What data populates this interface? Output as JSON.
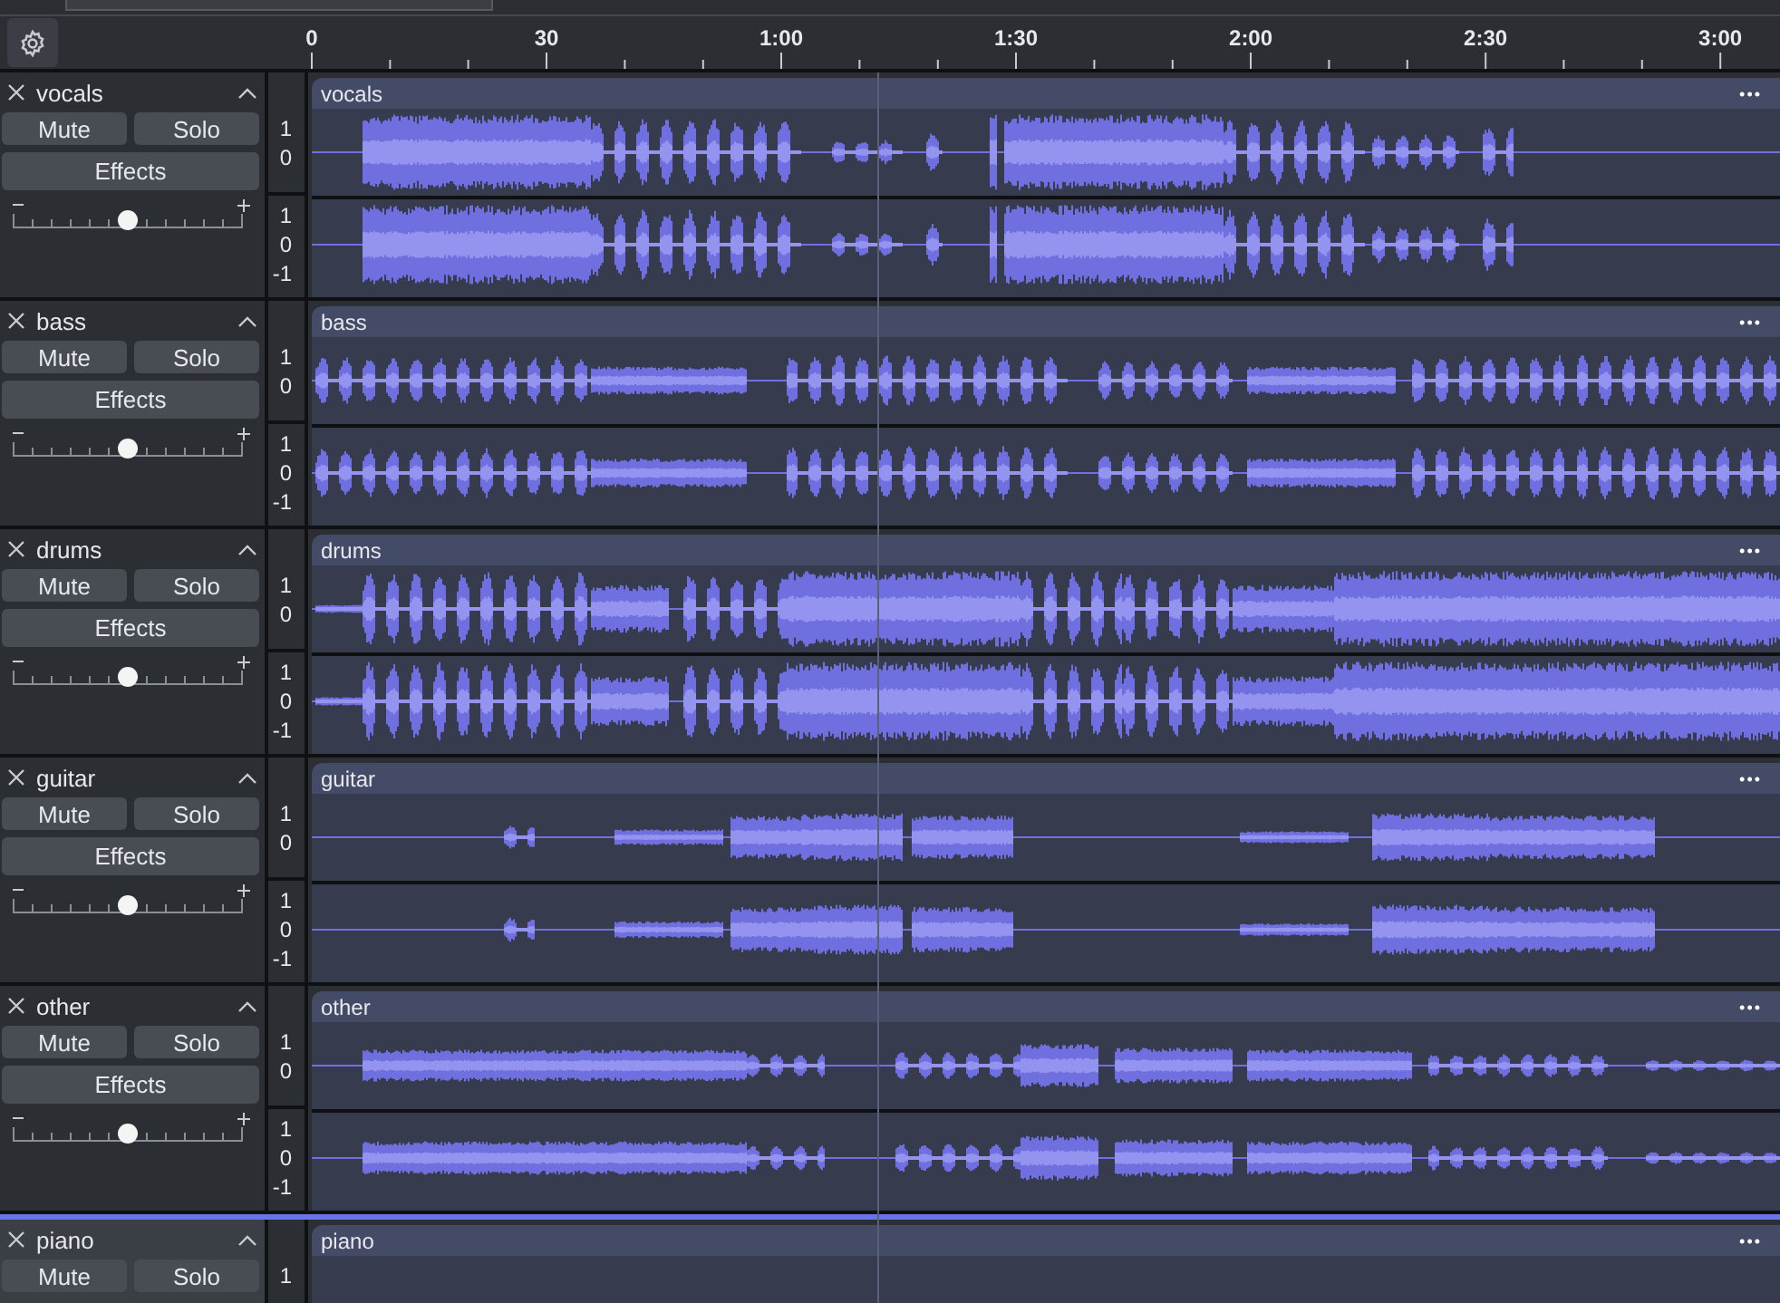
{
  "ruler": {
    "labels": [
      "0",
      "30",
      "1:00",
      "1:30",
      "2:00",
      "2:30",
      "3:00"
    ]
  },
  "tracks": [
    {
      "name": "vocals",
      "selected": false,
      "level": 0.5,
      "buttons": [
        "Mute",
        "Solo",
        "Effects"
      ],
      "clip_title": "vocals",
      "clip_menu": "•••",
      "channels": [
        {
          "scale": [
            "1",
            "0"
          ]
        },
        {
          "scale": [
            "1",
            "0",
            "-1"
          ]
        }
      ]
    },
    {
      "name": "bass",
      "selected": false,
      "level": 0.5,
      "buttons": [
        "Mute",
        "Solo",
        "Effects"
      ],
      "clip_title": "bass",
      "clip_menu": "•••",
      "channels": [
        {
          "scale": [
            "1",
            "0"
          ]
        },
        {
          "scale": [
            "1",
            "0",
            "-1"
          ]
        }
      ]
    },
    {
      "name": "drums",
      "selected": false,
      "level": 0.5,
      "buttons": [
        "Mute",
        "Solo",
        "Effects"
      ],
      "clip_title": "drums",
      "clip_menu": "•••",
      "channels": [
        {
          "scale": [
            "1",
            "0"
          ]
        },
        {
          "scale": [
            "1",
            "0",
            "-1"
          ]
        }
      ]
    },
    {
      "name": "guitar",
      "selected": false,
      "level": 0.5,
      "buttons": [
        "Mute",
        "Solo",
        "Effects"
      ],
      "clip_title": "guitar",
      "clip_menu": "•••",
      "channels": [
        {
          "scale": [
            "1",
            "0"
          ]
        },
        {
          "scale": [
            "1",
            "0",
            "-1"
          ]
        }
      ]
    },
    {
      "name": "other",
      "selected": false,
      "level": 0.5,
      "buttons": [
        "Mute",
        "Solo",
        "Effects"
      ],
      "clip_title": "other",
      "clip_menu": "•••",
      "channels": [
        {
          "scale": [
            "1",
            "0"
          ]
        },
        {
          "scale": [
            "1",
            "0",
            "-1"
          ]
        }
      ]
    },
    {
      "name": "piano",
      "selected": true,
      "buttons": [
        "Mute",
        "Solo"
      ],
      "clip_title": "piano",
      "clip_menu": "•••",
      "channels": [
        {
          "scale": [
            "1"
          ]
        }
      ]
    }
  ]
}
